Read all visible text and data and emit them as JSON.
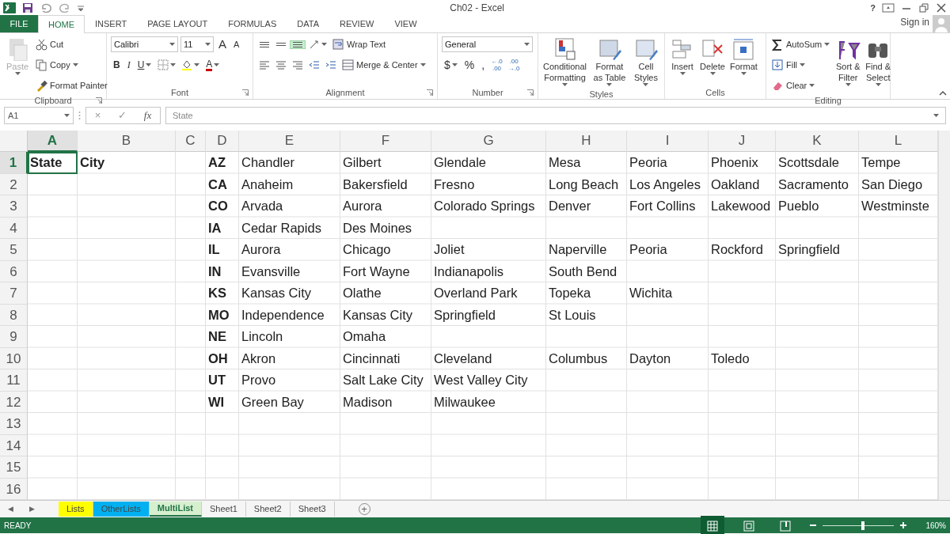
{
  "window": {
    "title": "Ch02 - Excel",
    "help": "?",
    "sign_in": "Sign in"
  },
  "ribbon_tabs": [
    {
      "label": "FILE",
      "kind": "file",
      "selected": false
    },
    {
      "label": "HOME",
      "kind": "tab",
      "selected": true
    },
    {
      "label": "INSERT",
      "kind": "tab",
      "selected": false
    },
    {
      "label": "PAGE LAYOUT",
      "kind": "tab",
      "selected": false
    },
    {
      "label": "FORMULAS",
      "kind": "tab",
      "selected": false
    },
    {
      "label": "DATA",
      "kind": "tab",
      "selected": false
    },
    {
      "label": "REVIEW",
      "kind": "tab",
      "selected": false
    },
    {
      "label": "VIEW",
      "kind": "tab",
      "selected": false
    }
  ],
  "ribbon_groups": [
    {
      "label": "Clipboard",
      "launcher": true,
      "items": [
        {
          "kind": "big",
          "label": "Paste",
          "dropdown": true,
          "disabled": true
        },
        {
          "kind": "small",
          "label": "Cut",
          "dropdown": false
        },
        {
          "kind": "small",
          "label": "Copy",
          "dropdown": true
        },
        {
          "kind": "small",
          "label": "Format Painter",
          "dropdown": false
        }
      ]
    },
    {
      "label": "Font",
      "launcher": true,
      "items": [
        {
          "kind": "combo",
          "text": "Calibri"
        },
        {
          "kind": "combo",
          "text": "11"
        },
        {
          "kind": "glyph",
          "text": "A",
          "dropdown": false
        },
        {
          "kind": "glyph",
          "text": "A",
          "dropdown": false
        },
        {
          "kind": "glyph",
          "text": "B",
          "dropdown": false
        },
        {
          "kind": "glyph",
          "text": "I",
          "dropdown": false
        },
        {
          "kind": "glyph",
          "text": "U",
          "dropdown": true
        },
        {
          "kind": "icon",
          "dropdown": true
        },
        {
          "kind": "icon",
          "dropdown": true
        },
        {
          "kind": "glyph",
          "text": "A",
          "dropdown": true
        }
      ]
    },
    {
      "label": "Alignment",
      "launcher": true,
      "items": [
        {
          "kind": "icon",
          "selected": false,
          "dropdown": false
        },
        {
          "kind": "icon",
          "selected": false,
          "dropdown": false
        },
        {
          "kind": "icon",
          "selected": true,
          "dropdown": false
        },
        {
          "kind": "icon",
          "selected": false,
          "dropdown": true
        },
        {
          "kind": "small",
          "label": "Wrap Text",
          "dropdown": false
        },
        {
          "kind": "icon",
          "selected": false,
          "dropdown": false
        },
        {
          "kind": "icon",
          "selected": false,
          "dropdown": false
        },
        {
          "kind": "icon",
          "selected": false,
          "dropdown": false
        },
        {
          "kind": "icon",
          "selected": false,
          "dropdown": false
        },
        {
          "kind": "icon",
          "selected": false,
          "dropdown": false
        },
        {
          "kind": "small",
          "label": "Merge & Center",
          "dropdown": true
        }
      ]
    },
    {
      "label": "Number",
      "launcher": true,
      "items": [
        {
          "kind": "combo",
          "text": "General"
        },
        {
          "kind": "glyph",
          "text": "$",
          "dropdown": true
        },
        {
          "kind": "glyph",
          "text": "%",
          "dropdown": false
        },
        {
          "kind": "glyph",
          "text": ",",
          "dropdown": false
        },
        {
          "kind": "stack",
          "lines": [
            "←.0",
            ".00"
          ]
        },
        {
          "kind": "stack",
          "lines": [
            ".00",
            "→.0"
          ]
        }
      ]
    },
    {
      "label": "Styles",
      "launcher": false,
      "items": [
        {
          "kind": "big",
          "label": "Conditional Formatting",
          "dropdown": true,
          "disabled": false
        },
        {
          "kind": "big",
          "label": "Format as Table",
          "dropdown": true,
          "disabled": false
        },
        {
          "kind": "big",
          "label": "Cell Styles",
          "dropdown": true,
          "disabled": false
        }
      ]
    },
    {
      "label": "Cells",
      "launcher": false,
      "items": [
        {
          "kind": "big",
          "label": "Insert",
          "dropdown": true,
          "disabled": false
        },
        {
          "kind": "big",
          "label": "Delete",
          "dropdown": true,
          "disabled": false
        },
        {
          "kind": "big",
          "label": "Format",
          "dropdown": true,
          "disabled": false
        }
      ]
    },
    {
      "label": "Editing",
      "launcher": false,
      "items": [
        {
          "kind": "small",
          "label": "AutoSum",
          "dropdown": true
        },
        {
          "kind": "small",
          "label": "Fill",
          "dropdown": true
        },
        {
          "kind": "small",
          "label": "Clear",
          "dropdown": true
        },
        {
          "kind": "big",
          "label": "Sort & Filter",
          "dropdown": true,
          "disabled": false
        },
        {
          "kind": "big",
          "label": "Find & Select",
          "dropdown": true,
          "disabled": false
        }
      ]
    }
  ],
  "formula_bar": {
    "name_box": "A1",
    "cancel": "×",
    "enter": "✓",
    "fx": "fx",
    "formula": "State"
  },
  "sheet": {
    "columns": [
      {
        "label": "A",
        "selected": true,
        "bold": true
      },
      {
        "label": "B",
        "selected": false,
        "bold": true
      },
      {
        "label": "C",
        "selected": false
      },
      {
        "label": "D",
        "selected": false,
        "bold": true
      },
      {
        "label": "E",
        "selected": false,
        "bold": false
      },
      {
        "label": "F",
        "selected": false,
        "bold": false
      },
      {
        "label": "G",
        "selected": false,
        "bold": false
      },
      {
        "label": "H",
        "selected": false,
        "bold": false
      },
      {
        "label": "I",
        "selected": false,
        "bold": false
      },
      {
        "label": "J",
        "selected": false,
        "bold": false
      },
      {
        "label": "K",
        "selected": false,
        "bold": false
      },
      {
        "label": "L",
        "selected": false,
        "bold": false
      }
    ],
    "rows": [
      {
        "label": "1",
        "selected": true,
        "cells": [
          "State",
          "City",
          null,
          "AZ",
          "Chandler",
          "Gilbert",
          "Glendale",
          "Mesa",
          "Peoria",
          "Phoenix",
          "Scottsdale",
          "Tempe"
        ]
      },
      {
        "label": "2",
        "selected": false,
        "cells": [
          null,
          null,
          null,
          "CA",
          "Anaheim",
          "Bakersfield",
          "Fresno",
          "Long Beach",
          "Los Angeles",
          "Oakland",
          "Sacramento",
          "San Diego"
        ]
      },
      {
        "label": "3",
        "selected": false,
        "cells": [
          null,
          null,
          null,
          "CO",
          "Arvada",
          "Aurora",
          "Colorado Springs",
          "Denver",
          "Fort Collins",
          "Lakewood",
          "Pueblo",
          "Westminste"
        ]
      },
      {
        "label": "4",
        "selected": false,
        "cells": [
          null,
          null,
          null,
          "IA",
          "Cedar Rapids",
          "Des Moines"
        ]
      },
      {
        "label": "5",
        "selected": false,
        "cells": [
          null,
          null,
          null,
          "IL",
          "Aurora",
          "Chicago",
          "Joliet",
          "Naperville",
          "Peoria",
          "Rockford",
          "Springfield"
        ]
      },
      {
        "label": "6",
        "selected": false,
        "cells": [
          null,
          null,
          null,
          "IN",
          "Evansville",
          "Fort Wayne",
          "Indianapolis",
          "South Bend"
        ]
      },
      {
        "label": "7",
        "selected": false,
        "cells": [
          null,
          null,
          null,
          "KS",
          "Kansas City",
          "Olathe",
          "Overland Park",
          "Topeka",
          "Wichita"
        ]
      },
      {
        "label": "8",
        "selected": false,
        "cells": [
          null,
          null,
          null,
          "MO",
          "Independence",
          "Kansas City",
          "Springfield",
          "St Louis"
        ]
      },
      {
        "label": "9",
        "selected": false,
        "cells": [
          null,
          null,
          null,
          "NE",
          "Lincoln",
          "Omaha"
        ]
      },
      {
        "label": "10",
        "selected": false,
        "cells": [
          null,
          null,
          null,
          "OH",
          "Akron",
          "Cincinnati",
          "Cleveland",
          "Columbus",
          "Dayton",
          "Toledo"
        ]
      },
      {
        "label": "11",
        "selected": false,
        "cells": [
          null,
          null,
          null,
          "UT",
          "Provo",
          "Salt Lake City",
          "West Valley City"
        ]
      },
      {
        "label": "12",
        "selected": false,
        "cells": [
          null,
          null,
          null,
          "WI",
          "Green Bay",
          "Madison",
          "Milwaukee"
        ]
      },
      {
        "label": "13",
        "selected": false
      },
      {
        "label": "14",
        "selected": false
      },
      {
        "label": "15",
        "selected": false
      },
      {
        "label": "16",
        "selected": false
      }
    ]
  },
  "sheet_tabs": {
    "prev": "◀",
    "next": "▶",
    "add": "+",
    "tabs": [
      {
        "label": "Lists",
        "color": "#ffff00",
        "selected": false
      },
      {
        "label": "OtherLists",
        "color": "#00b0f0",
        "selected": false
      },
      {
        "label": "MultiList",
        "color": "#d6efce",
        "selected": true
      },
      {
        "label": "Sheet1",
        "selected": false
      },
      {
        "label": "Sheet2",
        "selected": false
      },
      {
        "label": "Sheet3",
        "selected": false
      }
    ]
  },
  "status_bar": {
    "status": "READY",
    "views": [
      {
        "selected": true
      },
      {
        "selected": false
      },
      {
        "selected": false
      }
    ],
    "zoom": "160%",
    "zoom_slider": {
      "level": 0.56
    }
  }
}
